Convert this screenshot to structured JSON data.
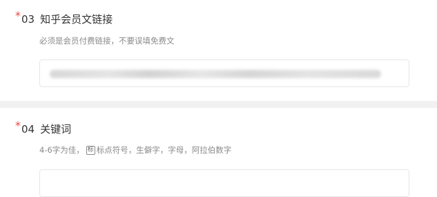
{
  "questions": [
    {
      "required_mark": "*",
      "number": "03",
      "label": "知乎会员文链接",
      "hint": "必须是会员付费链接，不要误填免费文"
    },
    {
      "required_mark": "*",
      "number": "04",
      "label": "关键词",
      "hint_before": "4-6字为佳，",
      "hint_icon": "标",
      "hint_after": "标点符号，生僻字，字母，阿拉伯数字"
    }
  ],
  "colors": {
    "required": "#e84a3c",
    "title": "#333333",
    "hint": "#8a8a8a",
    "divider": "#f1f1f1",
    "input_border": "#e6e6e6"
  }
}
